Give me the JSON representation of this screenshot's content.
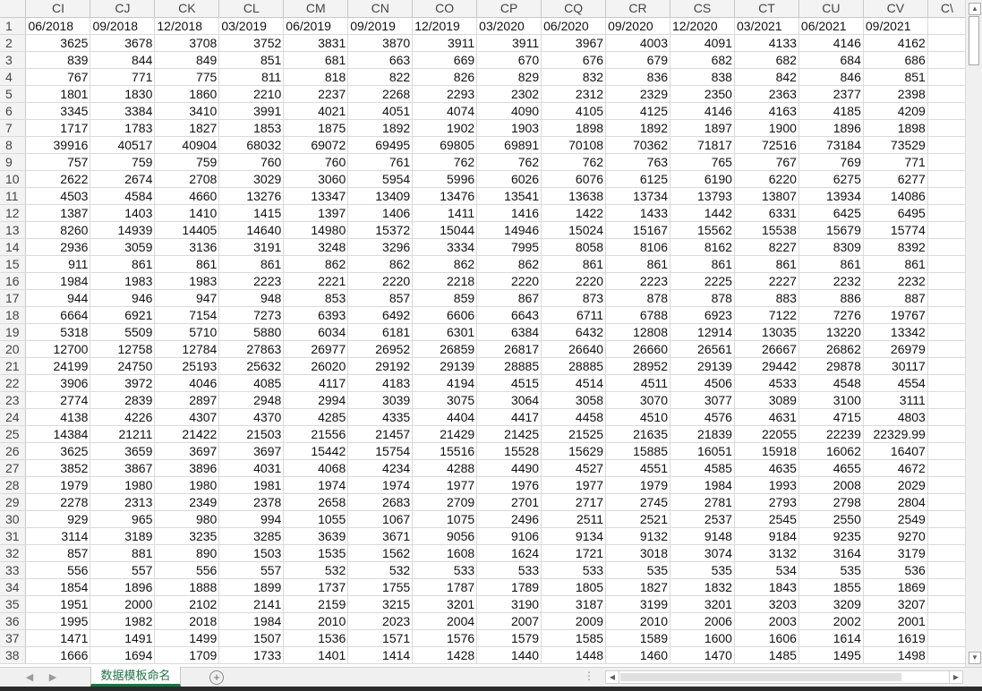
{
  "columns": [
    "CI",
    "CJ",
    "CK",
    "CL",
    "CM",
    "CN",
    "CO",
    "CP",
    "CQ",
    "CR",
    "CS",
    "CT",
    "CU",
    "CV",
    "CW"
  ],
  "column_headers_display": [
    "CI",
    "CJ",
    "CK",
    "CL",
    "CM",
    "CN",
    "CO",
    "CP",
    "CQ",
    "CR",
    "CS",
    "CT",
    "CU",
    "CV",
    "C\\"
  ],
  "rows": [
    {
      "n": "1",
      "cells": [
        "06/2018",
        "09/2018",
        "12/2018",
        "03/2019",
        "06/2019",
        "09/2019",
        "12/2019",
        "03/2020",
        "06/2020",
        "09/2020",
        "12/2020",
        "03/2021",
        "06/2021",
        "09/2021",
        ""
      ]
    },
    {
      "n": "2",
      "cells": [
        "3625",
        "3678",
        "3708",
        "3752",
        "3831",
        "3870",
        "3911",
        "3911",
        "3967",
        "4003",
        "4091",
        "4133",
        "4146",
        "4162",
        ""
      ]
    },
    {
      "n": "3",
      "cells": [
        "839",
        "844",
        "849",
        "851",
        "681",
        "663",
        "669",
        "670",
        "676",
        "679",
        "682",
        "682",
        "684",
        "686",
        ""
      ]
    },
    {
      "n": "4",
      "cells": [
        "767",
        "771",
        "775",
        "811",
        "818",
        "822",
        "826",
        "829",
        "832",
        "836",
        "838",
        "842",
        "846",
        "851",
        ""
      ]
    },
    {
      "n": "5",
      "cells": [
        "1801",
        "1830",
        "1860",
        "2210",
        "2237",
        "2268",
        "2293",
        "2302",
        "2312",
        "2329",
        "2350",
        "2363",
        "2377",
        "2398",
        ""
      ]
    },
    {
      "n": "6",
      "cells": [
        "3345",
        "3384",
        "3410",
        "3991",
        "4021",
        "4051",
        "4074",
        "4090",
        "4105",
        "4125",
        "4146",
        "4163",
        "4185",
        "4209",
        ""
      ]
    },
    {
      "n": "7",
      "cells": [
        "1717",
        "1783",
        "1827",
        "1853",
        "1875",
        "1892",
        "1902",
        "1903",
        "1898",
        "1892",
        "1897",
        "1900",
        "1896",
        "1898",
        ""
      ]
    },
    {
      "n": "8",
      "cells": [
        "39916",
        "40517",
        "40904",
        "68032",
        "69072",
        "69495",
        "69805",
        "69891",
        "70108",
        "70362",
        "71817",
        "72516",
        "73184",
        "73529",
        ""
      ]
    },
    {
      "n": "9",
      "cells": [
        "757",
        "759",
        "759",
        "760",
        "760",
        "761",
        "762",
        "762",
        "762",
        "763",
        "765",
        "767",
        "769",
        "771",
        ""
      ]
    },
    {
      "n": "10",
      "cells": [
        "2622",
        "2674",
        "2708",
        "3029",
        "3060",
        "5954",
        "5996",
        "6026",
        "6076",
        "6125",
        "6190",
        "6220",
        "6275",
        "6277",
        ""
      ]
    },
    {
      "n": "11",
      "cells": [
        "4503",
        "4584",
        "4660",
        "13276",
        "13347",
        "13409",
        "13476",
        "13541",
        "13638",
        "13734",
        "13793",
        "13807",
        "13934",
        "14086",
        ""
      ]
    },
    {
      "n": "12",
      "cells": [
        "1387",
        "1403",
        "1410",
        "1415",
        "1397",
        "1406",
        "1411",
        "1416",
        "1422",
        "1433",
        "1442",
        "6331",
        "6425",
        "6495",
        ""
      ]
    },
    {
      "n": "13",
      "cells": [
        "8260",
        "14939",
        "14405",
        "14640",
        "14980",
        "15372",
        "15044",
        "14946",
        "15024",
        "15167",
        "15562",
        "15538",
        "15679",
        "15774",
        ""
      ]
    },
    {
      "n": "14",
      "cells": [
        "2936",
        "3059",
        "3136",
        "3191",
        "3248",
        "3296",
        "3334",
        "7995",
        "8058",
        "8106",
        "8162",
        "8227",
        "8309",
        "8392",
        ""
      ]
    },
    {
      "n": "15",
      "cells": [
        "911",
        "861",
        "861",
        "861",
        "862",
        "862",
        "862",
        "862",
        "861",
        "861",
        "861",
        "861",
        "861",
        "861",
        ""
      ]
    },
    {
      "n": "16",
      "cells": [
        "1984",
        "1983",
        "1983",
        "2223",
        "2221",
        "2220",
        "2218",
        "2220",
        "2220",
        "2223",
        "2225",
        "2227",
        "2232",
        "2232",
        ""
      ]
    },
    {
      "n": "17",
      "cells": [
        "944",
        "946",
        "947",
        "948",
        "853",
        "857",
        "859",
        "867",
        "873",
        "878",
        "878",
        "883",
        "886",
        "887",
        ""
      ]
    },
    {
      "n": "18",
      "cells": [
        "6664",
        "6921",
        "7154",
        "7273",
        "6393",
        "6492",
        "6606",
        "6643",
        "6711",
        "6788",
        "6923",
        "7122",
        "7276",
        "19767",
        ""
      ]
    },
    {
      "n": "19",
      "cells": [
        "5318",
        "5509",
        "5710",
        "5880",
        "6034",
        "6181",
        "6301",
        "6384",
        "6432",
        "12808",
        "12914",
        "13035",
        "13220",
        "13342",
        ""
      ]
    },
    {
      "n": "20",
      "cells": [
        "12700",
        "12758",
        "12784",
        "27863",
        "26977",
        "26952",
        "26859",
        "26817",
        "26640",
        "26660",
        "26561",
        "26667",
        "26862",
        "26979",
        ""
      ]
    },
    {
      "n": "21",
      "cells": [
        "24199",
        "24750",
        "25193",
        "25632",
        "26020",
        "29192",
        "29139",
        "28885",
        "28885",
        "28952",
        "29139",
        "29442",
        "29878",
        "30117",
        ""
      ]
    },
    {
      "n": "22",
      "cells": [
        "3906",
        "3972",
        "4046",
        "4085",
        "4117",
        "4183",
        "4194",
        "4515",
        "4514",
        "4511",
        "4506",
        "4533",
        "4548",
        "4554",
        ""
      ]
    },
    {
      "n": "23",
      "cells": [
        "2774",
        "2839",
        "2897",
        "2948",
        "2994",
        "3039",
        "3075",
        "3064",
        "3058",
        "3070",
        "3077",
        "3089",
        "3100",
        "3111",
        ""
      ]
    },
    {
      "n": "24",
      "cells": [
        "4138",
        "4226",
        "4307",
        "4370",
        "4285",
        "4335",
        "4404",
        "4417",
        "4458",
        "4510",
        "4576",
        "4631",
        "4715",
        "4803",
        ""
      ]
    },
    {
      "n": "25",
      "cells": [
        "14384",
        "21211",
        "21422",
        "21503",
        "21556",
        "21457",
        "21429",
        "21425",
        "21525",
        "21635",
        "21839",
        "22055",
        "22239",
        "22329.99",
        ""
      ]
    },
    {
      "n": "26",
      "cells": [
        "3625",
        "3659",
        "3697",
        "3697",
        "15442",
        "15754",
        "15516",
        "15528",
        "15629",
        "15885",
        "16051",
        "15918",
        "16062",
        "16407",
        ""
      ]
    },
    {
      "n": "27",
      "cells": [
        "3852",
        "3867",
        "3896",
        "4031",
        "4068",
        "4234",
        "4288",
        "4490",
        "4527",
        "4551",
        "4585",
        "4635",
        "4655",
        "4672",
        ""
      ]
    },
    {
      "n": "28",
      "cells": [
        "1979",
        "1980",
        "1980",
        "1981",
        "1974",
        "1974",
        "1977",
        "1976",
        "1977",
        "1979",
        "1984",
        "1993",
        "2008",
        "2029",
        ""
      ]
    },
    {
      "n": "29",
      "cells": [
        "2278",
        "2313",
        "2349",
        "2378",
        "2658",
        "2683",
        "2709",
        "2701",
        "2717",
        "2745",
        "2781",
        "2793",
        "2798",
        "2804",
        ""
      ]
    },
    {
      "n": "30",
      "cells": [
        "929",
        "965",
        "980",
        "994",
        "1055",
        "1067",
        "1075",
        "2496",
        "2511",
        "2521",
        "2537",
        "2545",
        "2550",
        "2549",
        ""
      ]
    },
    {
      "n": "31",
      "cells": [
        "3114",
        "3189",
        "3235",
        "3285",
        "3639",
        "3671",
        "9056",
        "9106",
        "9134",
        "9132",
        "9148",
        "9184",
        "9235",
        "9270",
        ""
      ]
    },
    {
      "n": "32",
      "cells": [
        "857",
        "881",
        "890",
        "1503",
        "1535",
        "1562",
        "1608",
        "1624",
        "1721",
        "3018",
        "3074",
        "3132",
        "3164",
        "3179",
        ""
      ]
    },
    {
      "n": "33",
      "cells": [
        "556",
        "557",
        "556",
        "557",
        "532",
        "532",
        "533",
        "533",
        "533",
        "535",
        "535",
        "534",
        "535",
        "536",
        ""
      ]
    },
    {
      "n": "34",
      "cells": [
        "1854",
        "1896",
        "1888",
        "1899",
        "1737",
        "1755",
        "1787",
        "1789",
        "1805",
        "1827",
        "1832",
        "1843",
        "1855",
        "1869",
        ""
      ]
    },
    {
      "n": "35",
      "cells": [
        "1951",
        "2000",
        "2102",
        "2141",
        "2159",
        "3215",
        "3201",
        "3190",
        "3187",
        "3199",
        "3201",
        "3203",
        "3209",
        "3207",
        ""
      ]
    },
    {
      "n": "36",
      "cells": [
        "1995",
        "1982",
        "2018",
        "1984",
        "2010",
        "2023",
        "2004",
        "2007",
        "2009",
        "2010",
        "2006",
        "2003",
        "2002",
        "2001",
        ""
      ]
    },
    {
      "n": "37",
      "cells": [
        "1471",
        "1491",
        "1499",
        "1507",
        "1536",
        "1571",
        "1576",
        "1579",
        "1585",
        "1589",
        "1600",
        "1606",
        "1614",
        "1619",
        ""
      ]
    },
    {
      "n": "38",
      "cells": [
        "1666",
        "1694",
        "1709",
        "1733",
        "1401",
        "1414",
        "1428",
        "1440",
        "1448",
        "1460",
        "1470",
        "1485",
        "1495",
        "1498",
        ""
      ]
    }
  ],
  "sheet_tab": {
    "label": "数据模板命名"
  },
  "add_sheet_symbol": "+",
  "more_dots": "⋮",
  "icons": {
    "scroll_up": "▲",
    "scroll_down": "▼",
    "scroll_left": "◀",
    "scroll_right": "▶",
    "prev_sheet": "◀",
    "next_sheet": "▶"
  },
  "colors": {
    "accent": "#217346",
    "header_bg": "#f3f3f3",
    "gridline": "#dadada"
  }
}
